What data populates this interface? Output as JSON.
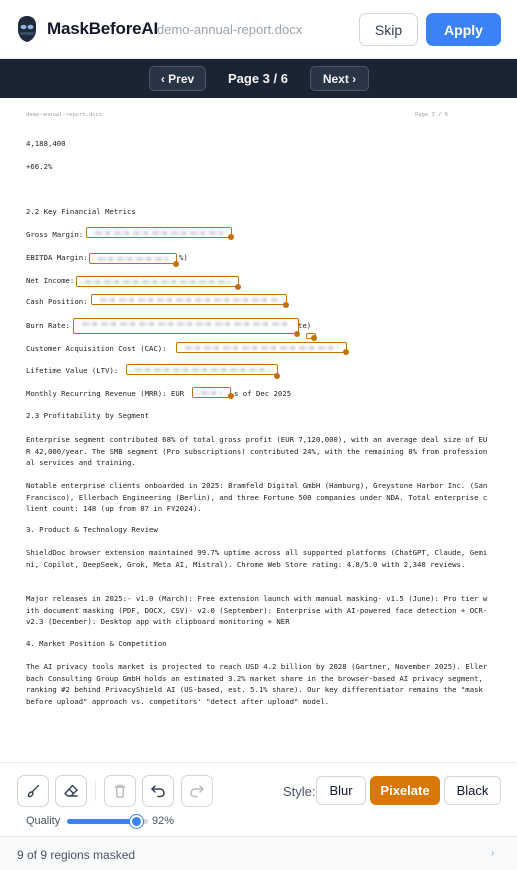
{
  "header": {
    "app_name": "MaskBeforeAI",
    "file_name": "demo-annual-report.docx",
    "skip_label": "Skip",
    "apply_label": "Apply",
    "logo_icon": "mask-logo-icon",
    "accent_color": "#3b82f6"
  },
  "pager": {
    "prev_label": "‹ Prev",
    "page_label": "Page 3 / 6",
    "next_label": "Next ›"
  },
  "document": {
    "head_left": "demo-annual-report.docx",
    "head_right": "Page 3 / 6",
    "line_num1": "4,188,400",
    "line_num2": "+66.2%",
    "section_22": "2.2 Key Financial Metrics",
    "gross_margin": "Gross Margin:",
    "ebitda_margin": "EBITDA Margin:",
    "ebitda_suffix": "%)",
    "net_income": "Net Income:",
    "cash_position": "Cash Position:",
    "burn_rate": "Burn Rate:",
    "burn_suffix": "te)",
    "cac": "Customer Acquisition Cost (CAC):",
    "ltv": "Lifetime Value (LTV):",
    "mrr_prefix": "Monthly Recurring Revenue (MRR): EUR",
    "mrr_suffix": "s of Dec 2025",
    "section_23": "2.3 Profitability by Segment",
    "para_segment": "Enterprise segment contributed 68% of total gross profit (EUR 7,120,000), with an average deal size of EUR 42,000/year. The SMB segment (Pro subscriptions) contributed 24%, with the remaining 8% from professional services and training.",
    "para_clients": "Notable enterprise clients onboarded in 2025: Bramfeld Digital GmbH (Hamburg), Greystone Harbor Inc. (San Francisco), Ellerbach Engineering (Berlin), and three Fortune 500 companies under NDA. Total enterprise client count: 148 (up from 87 in FY2024).",
    "section_3": "3. Product & Technology Review",
    "para_product": "ShieldDoc browser extension maintained 99.7% uptime across all supported platforms (ChatGPT, Claude, Gemini, Copilot, DeepSeek, Grok, Meta AI, Mistral). Chrome Web Store rating: 4.8/5.0 with 2,340 reviews.",
    "para_releases": "Major releases in 2025:- v1.0 (March): Free extension launch with manual masking- v1.5 (June): Pro tier with document masking (PDF, DOCX, CSV)- v2.0 (September): Enterprise with AI-powered face detection + OCR- v2.3 (December): Desktop app with clipboard monitoring + NER",
    "section_4": "4. Market Position & Competition",
    "para_market": "The AI privacy tools market is projected to reach USD 4.2 billion by 2028 (Gartner, November 2025). Ellerbach Consulting Group GmbH holds an estimated 3.2% market share in the browser-based AI privacy segment, ranking #2 behind PrivacyShield AI (US-based, est. 5.1% share). Our key differentiator remains the \"mask before upload\" approach vs. competitors' \"detect after upload\" model.",
    "mask_color": "#c2700e"
  },
  "toolbar": {
    "tools": [
      "brush-icon",
      "eraser-icon",
      "trash-icon",
      "undo-icon",
      "redo-icon"
    ],
    "style_label": "Style:",
    "style_blur": "Blur",
    "style_pixelate": "Pixelate",
    "style_black": "Black",
    "selected_style": "Pixelate",
    "selected_color": "#d97706",
    "quality_label": "Quality",
    "quality_value": "92%",
    "quality_fraction": 0.92
  },
  "status": {
    "text": "9 of 9 regions masked",
    "caret": "›"
  }
}
